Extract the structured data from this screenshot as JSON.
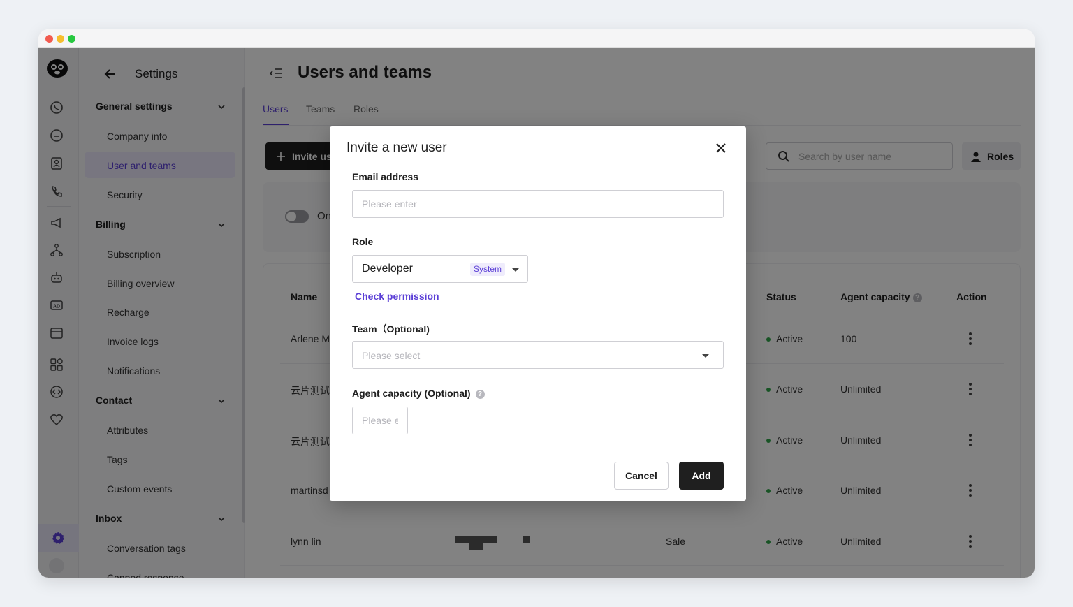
{
  "sidebar": {
    "title": "Settings",
    "sections": [
      {
        "label": "General settings",
        "items": [
          "Company info",
          "User and teams",
          "Security"
        ]
      },
      {
        "label": "Billing",
        "items": [
          "Subscription",
          "Billing overview",
          "Recharge",
          "Invoice logs",
          "Notifications"
        ]
      },
      {
        "label": "Contact",
        "items": [
          "Attributes",
          "Tags",
          "Custom events"
        ]
      },
      {
        "label": "Inbox",
        "items": [
          "Conversation tags",
          "Canned response"
        ]
      }
    ],
    "active_item": "User and teams"
  },
  "main": {
    "title": "Users and teams",
    "tabs": [
      "Users",
      "Teams",
      "Roles"
    ],
    "active_tab": "Users",
    "invite_button": "Invite us",
    "search_placeholder": "Search by user name",
    "roles_button": "Roles",
    "toggle_label": "On",
    "table": {
      "columns": [
        "Name",
        "Status",
        "Agent capacity",
        "Action"
      ],
      "rows": [
        {
          "name": "Arlene M",
          "role": "",
          "status": "Active",
          "capacity": "100"
        },
        {
          "name": "云片测试",
          "role": "",
          "status": "Active",
          "capacity": "Unlimited"
        },
        {
          "name": "云片测试",
          "role": "",
          "status": "Active",
          "capacity": "Unlimited"
        },
        {
          "name": "martinsd",
          "role": "",
          "status": "Active",
          "capacity": "Unlimited"
        },
        {
          "name": "lynn lin",
          "role": "Sale",
          "status": "Active",
          "capacity": "Unlimited"
        }
      ]
    }
  },
  "modal": {
    "title": "Invite a new user",
    "email_label": "Email address",
    "email_placeholder": "Please enter",
    "role_label": "Role",
    "role_value": "Developer",
    "role_badge": "System",
    "check_permission": "Check permission",
    "team_label": "Team（Optional)",
    "team_placeholder": "Please select",
    "capacity_label": "Agent capacity (Optional)",
    "capacity_placeholder": "Please enter",
    "cancel_button": "Cancel",
    "add_button": "Add"
  },
  "colors": {
    "accent": "#5b3fd6",
    "primary_button": "#1f1f1f",
    "status_active": "#2fa54a"
  },
  "icons": [
    "logo-icon",
    "whatsapp-icon",
    "chat-icon",
    "contacts-icon",
    "phone-icon",
    "megaphone-icon",
    "flow-icon",
    "bot-icon",
    "ad-icon",
    "calendar-icon",
    "apps-icon",
    "developer-icon",
    "heart-icon",
    "gear-icon",
    "back-arrow-icon",
    "collapse-icon",
    "plus-icon",
    "search-icon",
    "user-icon",
    "close-icon"
  ]
}
